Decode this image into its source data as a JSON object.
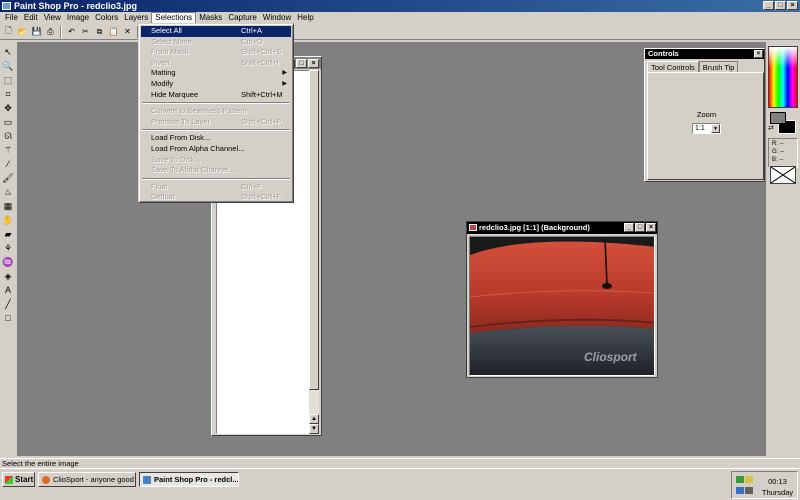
{
  "window": {
    "title": "Paint Shop Pro - redclio3.jpg",
    "buttons": {
      "minimize": "_",
      "maximize": "□",
      "close": "×"
    }
  },
  "menubar": {
    "items": [
      "File",
      "Edit",
      "View",
      "Image",
      "Colors",
      "Layers",
      "Selections",
      "Masks",
      "Capture",
      "Window",
      "Help"
    ],
    "active": "Selections"
  },
  "selections_menu": {
    "items": [
      {
        "label": "Select All",
        "shortcut": "Ctrl+A",
        "state": "highlighted"
      },
      {
        "label": "Select None",
        "shortcut": "Ctrl+D",
        "state": "disabled"
      },
      {
        "label": "From Mask",
        "shortcut": "Shift+Ctrl+S",
        "state": "disabled"
      },
      {
        "label": "Invert",
        "shortcut": "Shift+Ctrl+I",
        "state": "disabled"
      },
      {
        "label": "Matting",
        "shortcut": "",
        "state": "enabled",
        "submenu": true
      },
      {
        "label": "Modify",
        "shortcut": "",
        "state": "enabled",
        "submenu": true
      },
      {
        "label": "Hide Marquee",
        "shortcut": "Shift+Ctrl+M",
        "state": "enabled"
      },
      {
        "separator": true
      },
      {
        "label": "Convert to Seamless Pattern",
        "shortcut": "",
        "state": "disabled"
      },
      {
        "label": "Promote To Layer",
        "shortcut": "Shift+Ctrl+P",
        "state": "disabled"
      },
      {
        "separator": true
      },
      {
        "label": "Load From Disk...",
        "shortcut": "",
        "state": "enabled"
      },
      {
        "label": "Load From Alpha Channel...",
        "shortcut": "",
        "state": "enabled"
      },
      {
        "label": "Save To Disk...",
        "shortcut": "",
        "state": "disabled"
      },
      {
        "label": "Save To Alpha Channel...",
        "shortcut": "",
        "state": "disabled"
      },
      {
        "separator": true
      },
      {
        "label": "Float",
        "shortcut": "Ctrl+F",
        "state": "disabled"
      },
      {
        "label": "Defloat",
        "shortcut": "Shift+Ctrl+F",
        "state": "disabled"
      }
    ]
  },
  "toolbar": {
    "icons": [
      "new-file-icon",
      "open-folder-icon",
      "save-icon",
      "print-icon",
      "undo-icon",
      "cut-icon",
      "copy-icon",
      "paste-icon",
      "delete-icon",
      "screen-capture-icon"
    ],
    "glyphs": [
      "🗋",
      "📂",
      "💾",
      "⎙",
      "↶",
      "✂",
      "⧉",
      "📋",
      "✕",
      "▭"
    ]
  },
  "tools": [
    {
      "name": "arrow-tool-icon",
      "glyph": "↖"
    },
    {
      "name": "zoom-tool-icon",
      "glyph": "🔍"
    },
    {
      "name": "deformation-tool-icon",
      "glyph": "⬚"
    },
    {
      "name": "crop-tool-icon",
      "glyph": "⌗"
    },
    {
      "name": "mover-tool-icon",
      "glyph": "✥"
    },
    {
      "name": "selection-tool-icon",
      "glyph": "▭"
    },
    {
      "name": "freehand-selection-icon",
      "glyph": "ᘏ"
    },
    {
      "name": "magic-wand-icon",
      "glyph": "⚚"
    },
    {
      "name": "dropper-icon",
      "glyph": "⁄"
    },
    {
      "name": "paintbrush-icon",
      "glyph": "🖌"
    },
    {
      "name": "clone-brush-icon",
      "glyph": "♨"
    },
    {
      "name": "color-replacer-icon",
      "glyph": "▦"
    },
    {
      "name": "retouch-icon",
      "glyph": "✋"
    },
    {
      "name": "eraser-icon",
      "glyph": "▰"
    },
    {
      "name": "picture-tube-icon",
      "glyph": "⚘"
    },
    {
      "name": "airbrush-icon",
      "glyph": "♒"
    },
    {
      "name": "flood-fill-icon",
      "glyph": "◈"
    },
    {
      "name": "text-tool-icon",
      "glyph": "A"
    },
    {
      "name": "draw-line-icon",
      "glyph": "╱"
    },
    {
      "name": "preset-shape-icon",
      "glyph": "□"
    }
  ],
  "doc_window": {
    "buttons": [
      "_",
      "□",
      "×"
    ],
    "scroll": {
      "up": "▲",
      "down": "▼"
    }
  },
  "controls_panel": {
    "title": "Controls",
    "close": "×",
    "tabs": [
      "Tool Controls",
      "Brush Tip"
    ],
    "selected_tab": "Tool Controls",
    "zoom_label": "Zoom",
    "zoom_value": "1:1",
    "dropdown_arrow": "▼"
  },
  "image_window": {
    "title": "redclio3.jpg [1:1] (Background)",
    "watermark": "Cliosport",
    "buttons": [
      "_",
      "□",
      "×"
    ]
  },
  "palette": {
    "swap_glyph": "⇄",
    "rgb": {
      "r": "R: --",
      "g": "G: --",
      "b": "B: --"
    }
  },
  "statusbar": {
    "text": "Select the entire image"
  },
  "taskbar": {
    "start": "Start",
    "tasks": [
      {
        "label": "ClioSport - anyone good ...",
        "pressed": false
      },
      {
        "label": "Paint Shop Pro - redcl...",
        "pressed": true
      }
    ],
    "clock": {
      "time": "00:13",
      "day": "Thursday"
    }
  },
  "colors": {
    "titlebar_active": "#0a246a",
    "selection_highlight": "#0a246a",
    "workspace": "#808080",
    "chrome": "#d4d0c8",
    "car_red": "#c0392b"
  }
}
